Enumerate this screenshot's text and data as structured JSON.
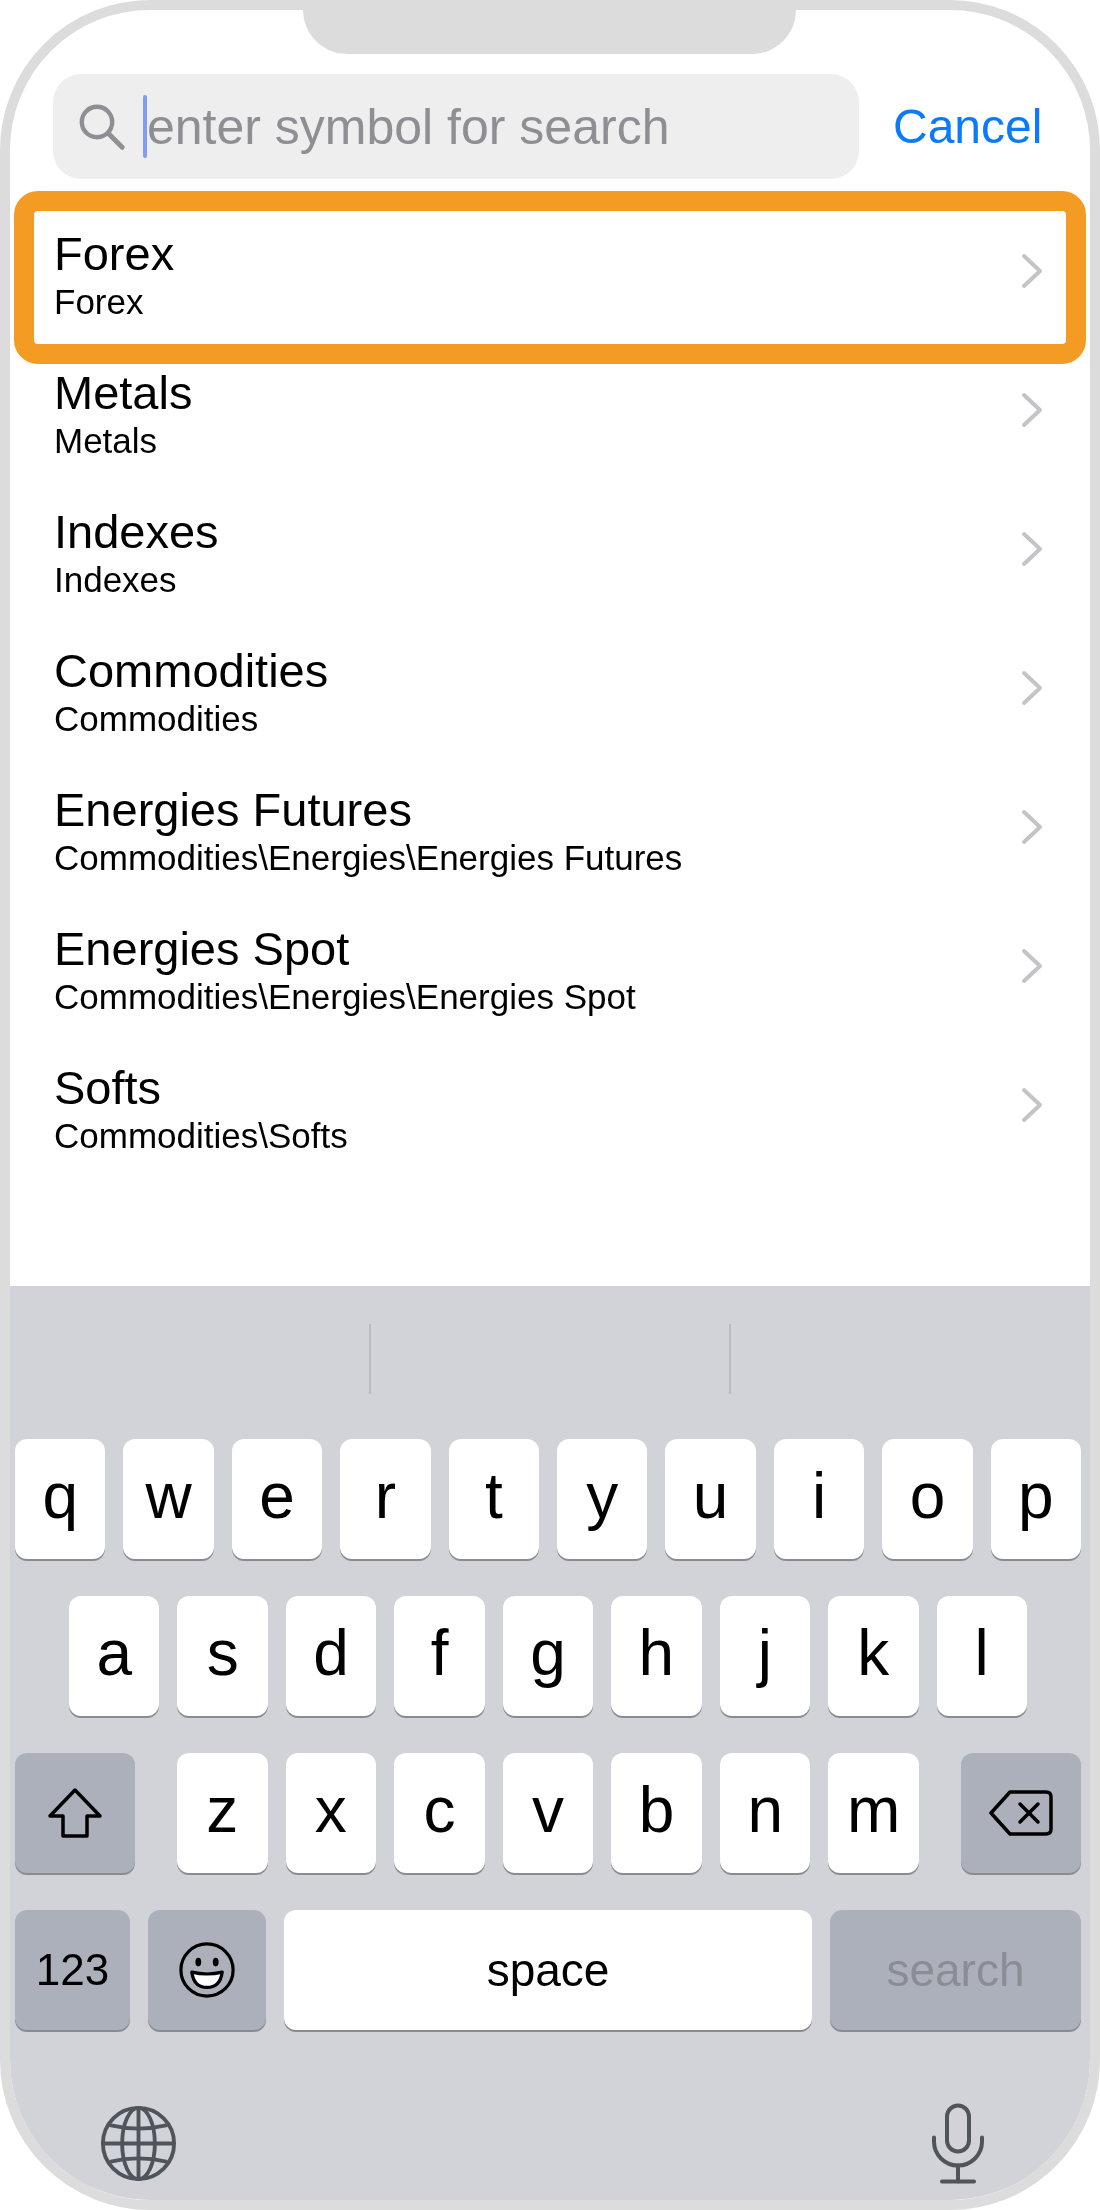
{
  "search": {
    "placeholder": "enter symbol for search",
    "focused": true
  },
  "cancel_button": "Cancel",
  "categories": [
    {
      "title": "Forex",
      "path": "Forex",
      "highlighted": true
    },
    {
      "title": "Metals",
      "path": "Metals",
      "highlighted": false
    },
    {
      "title": "Indexes",
      "path": "Indexes",
      "highlighted": false
    },
    {
      "title": "Commodities",
      "path": "Commodities",
      "highlighted": false
    },
    {
      "title": "Energies Futures",
      "path": "Commodities\\Energies\\Energies Futures",
      "highlighted": false
    },
    {
      "title": "Energies Spot",
      "path": "Commodities\\Energies\\Energies Spot",
      "highlighted": false
    },
    {
      "title": "Softs",
      "path": "Commodities\\Softs",
      "highlighted": false
    }
  ],
  "keyboard": {
    "letter_rows": [
      [
        "q",
        "w",
        "e",
        "r",
        "t",
        "y",
        "u",
        "i",
        "o",
        "p"
      ],
      [
        "a",
        "s",
        "d",
        "f",
        "g",
        "h",
        "j",
        "k",
        "l"
      ],
      [
        "z",
        "x",
        "c",
        "v",
        "b",
        "n",
        "m"
      ]
    ],
    "numbers_key": "123",
    "space_key": "space",
    "search_key": {
      "label": "search",
      "disabled": true
    }
  }
}
